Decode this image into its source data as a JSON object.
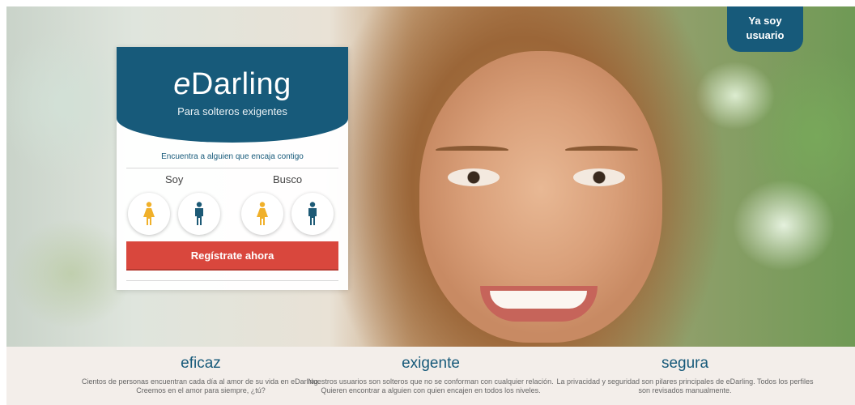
{
  "header": {
    "login_label_line1": "Ya soy",
    "login_label_line2": "usuario"
  },
  "card": {
    "logo_e": "e",
    "logo_rest": "Darling",
    "tagline": "Para solteros exigentes",
    "prompt": "Encuentra a alguien que encaja contigo",
    "soy_label": "Soy",
    "busco_label": "Busco",
    "register_label": "Regístrate ahora"
  },
  "features": [
    {
      "title": "eficaz",
      "text": "Cientos de personas encuentran cada día al amor de su vida en eDarling. Creemos en el amor para siempre, ¿tú?"
    },
    {
      "title": "exigente",
      "text": "Nuestros usuarios son solteros que no se conforman con cualquier relación. Quieren encontrar a alguien con quien encajen en todos los niveles."
    },
    {
      "title": "segura",
      "text": "La privacidad y seguridad son pilares principales de eDarling. Todos los perfiles son revisados manualmente."
    }
  ],
  "colors": {
    "brand": "#175a7a",
    "cta": "#d9473d",
    "female_icon": "#f0b02a",
    "male_icon": "#1d5a76"
  },
  "icons": {
    "female": "female-figure-icon",
    "male": "male-figure-icon"
  }
}
